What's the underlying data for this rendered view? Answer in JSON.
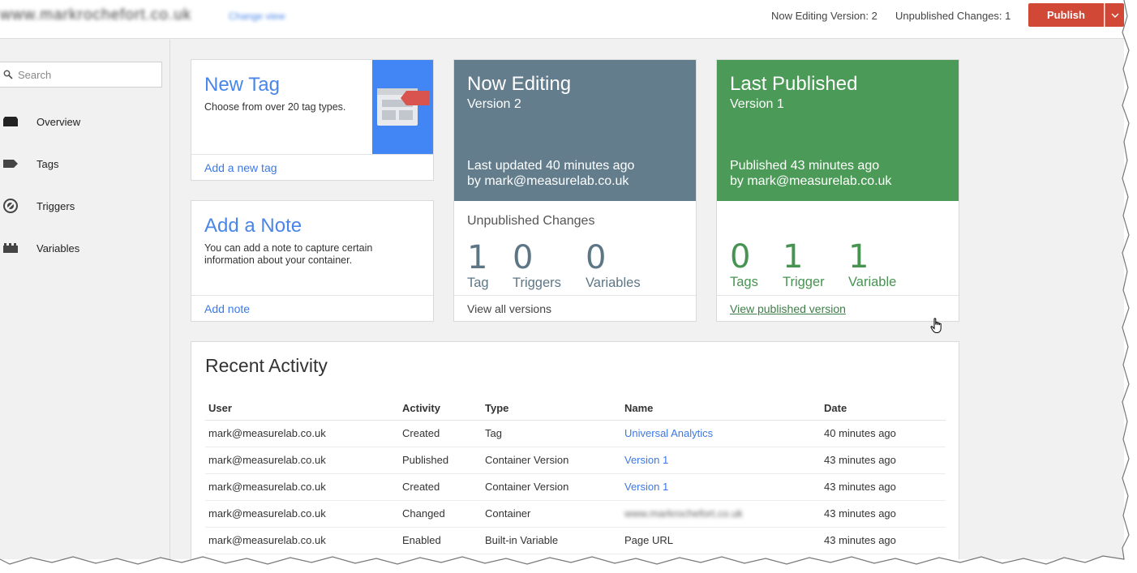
{
  "header": {
    "container_name": "www.markrochefort.co.uk",
    "container_link": "Change view",
    "now_editing": "Now Editing Version: 2",
    "unpublished": "Unpublished Changes: 1",
    "publish_label": "Publish",
    "accent_color": "#d14836"
  },
  "sidebar": {
    "search_placeholder": "Search",
    "items": [
      {
        "label": "Overview",
        "icon": "overview-icon"
      },
      {
        "label": "Tags",
        "icon": "tag-icon"
      },
      {
        "label": "Triggers",
        "icon": "trigger-icon"
      },
      {
        "label": "Variables",
        "icon": "variable-icon"
      }
    ]
  },
  "new_tag": {
    "title": "New Tag",
    "description": "Choose from over 20 tag types.",
    "action": "Add a new tag"
  },
  "add_note": {
    "title": "Add a Note",
    "description": "You can add a note to capture certain information about your container.",
    "action": "Add note"
  },
  "now_editing_card": {
    "title": "Now Editing",
    "version": "Version 2",
    "updated": "Last updated 40 minutes ago",
    "by": "by mark@measurelab.co.uk",
    "section": "Unpublished Changes",
    "stats": [
      {
        "value": "1",
        "label": "Tag"
      },
      {
        "value": "0",
        "label": "Triggers"
      },
      {
        "value": "0",
        "label": "Variables"
      }
    ],
    "action": "View all versions",
    "color": "#637d8c"
  },
  "last_published_card": {
    "title": "Last Published",
    "version": "Version 1",
    "published": "Published 43 minutes ago",
    "by": "by mark@measurelab.co.uk",
    "stats": [
      {
        "value": "0",
        "label": "Tags"
      },
      {
        "value": "1",
        "label": "Trigger"
      },
      {
        "value": "1",
        "label": "Variable"
      }
    ],
    "action": "View published version",
    "color": "#4c9a57"
  },
  "recent": {
    "title": "Recent Activity",
    "columns": [
      "User",
      "Activity",
      "Type",
      "Name",
      "Date"
    ],
    "rows": [
      {
        "user": "mark@measurelab.co.uk",
        "activity": "Created",
        "type": "Tag",
        "name": "Universal Analytics",
        "date": "40 minutes ago"
      },
      {
        "user": "mark@measurelab.co.uk",
        "activity": "Published",
        "type": "Container Version",
        "name": "Version 1",
        "date": "43 minutes ago"
      },
      {
        "user": "mark@measurelab.co.uk",
        "activity": "Created",
        "type": "Container Version",
        "name": "Version 1",
        "date": "43 minutes ago"
      },
      {
        "user": "mark@measurelab.co.uk",
        "activity": "Changed",
        "type": "Container",
        "name": "www.markrochefort.co.uk",
        "date": "43 minutes ago"
      },
      {
        "user": "mark@measurelab.co.uk",
        "activity": "Enabled",
        "type": "Built-in Variable",
        "name": "Page URL",
        "date": "43 minutes ago"
      }
    ]
  }
}
